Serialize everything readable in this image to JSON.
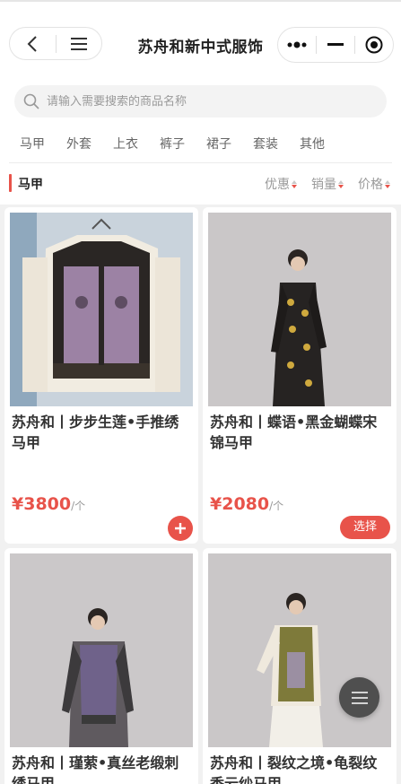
{
  "nav": {
    "title": "苏舟和新中式服饰",
    "back_icon": "back-chevron-icon",
    "menu_icon": "hamburger-icon",
    "more_icon": "more-dots-icon",
    "minimize_icon": "minimize-icon",
    "close_icon": "target-circle-icon"
  },
  "search": {
    "placeholder": "请输入需要搜索的商品名称"
  },
  "categories": [
    "马甲",
    "外套",
    "上衣",
    "裤子",
    "裙子",
    "套装",
    "其他"
  ],
  "section": {
    "title": "马甲",
    "sorts": [
      "优惠",
      "销量",
      "价格"
    ]
  },
  "products": [
    {
      "name": "苏舟和丨步步生莲•手推绣马甲",
      "price": "¥3800",
      "unit": "/个",
      "action": "add"
    },
    {
      "name": "苏舟和丨蝶语•黑金蝴蝶宋锦马甲",
      "price": "¥2080",
      "unit": "/个",
      "action": "选择"
    },
    {
      "name": "苏舟和丨瑾萦•真丝老缎刺绣马甲",
      "price": "",
      "unit": "",
      "action": ""
    },
    {
      "name": "苏舟和丨裂纹之境•龟裂纹香云纱马甲",
      "price": "",
      "unit": "",
      "action": ""
    }
  ],
  "colors": {
    "accent": "#e8534a",
    "float_button": "#4f4f4f"
  }
}
